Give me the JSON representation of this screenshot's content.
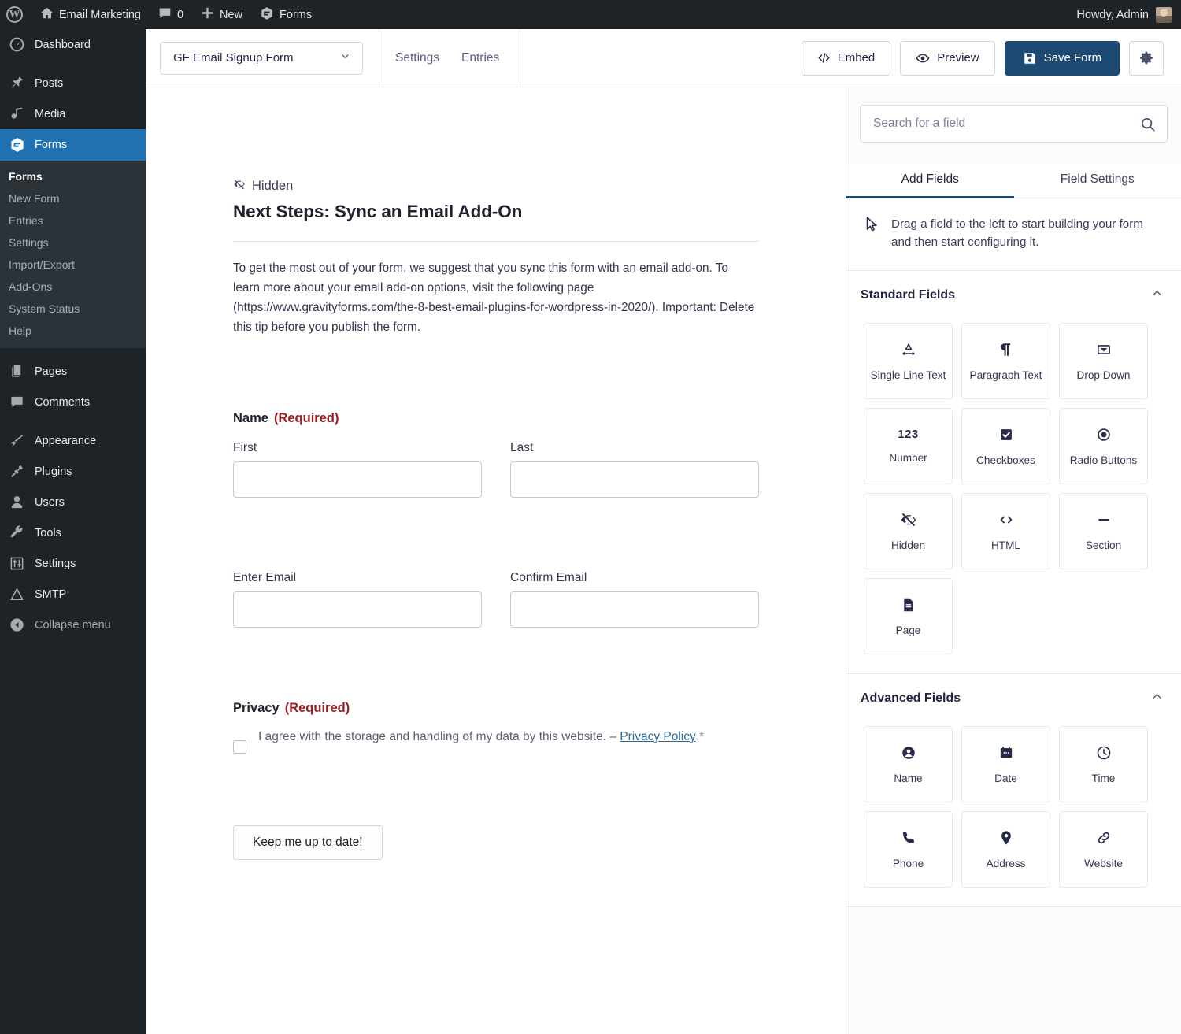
{
  "adminbar": {
    "site_title": "Email Marketing",
    "comments_count": "0",
    "new_label": "New",
    "forms_label": "Forms",
    "howdy": "Howdy, Admin"
  },
  "adminmenu": {
    "items": [
      {
        "label": "Dashboard",
        "icon": "dashboard-icon",
        "current": false
      },
      {
        "label": "Posts",
        "icon": "pin-icon",
        "current": false
      },
      {
        "label": "Media",
        "icon": "media-icon",
        "current": false
      },
      {
        "label": "Forms",
        "icon": "gravityforms-icon",
        "current": true
      }
    ],
    "submenu": [
      {
        "label": "Forms",
        "current": true
      },
      {
        "label": "New Form",
        "current": false
      },
      {
        "label": "Entries",
        "current": false
      },
      {
        "label": "Settings",
        "current": false
      },
      {
        "label": "Import/Export",
        "current": false
      },
      {
        "label": "Add-Ons",
        "current": false
      },
      {
        "label": "System Status",
        "current": false
      },
      {
        "label": "Help",
        "current": false
      }
    ],
    "items2": [
      {
        "label": "Pages",
        "icon": "pages-icon"
      },
      {
        "label": "Comments",
        "icon": "comment-icon"
      }
    ],
    "items3": [
      {
        "label": "Appearance",
        "icon": "brush-icon"
      },
      {
        "label": "Plugins",
        "icon": "plug-icon"
      },
      {
        "label": "Users",
        "icon": "user-icon"
      },
      {
        "label": "Tools",
        "icon": "wrench-icon"
      },
      {
        "label": "Settings",
        "icon": "sliders-icon"
      },
      {
        "label": "SMTP",
        "icon": "triangle-icon"
      }
    ],
    "collapse_label": "Collapse menu"
  },
  "editor_bar": {
    "form_name": "GF Email Signup Form",
    "tabs": [
      {
        "label": "Settings"
      },
      {
        "label": "Entries"
      }
    ],
    "embed_label": "Embed",
    "preview_label": "Preview",
    "save_label": "Save Form",
    "settings_icon": "gear-icon",
    "primary_color": "#1c4a72"
  },
  "form": {
    "html_field": {
      "tag": "Hidden",
      "tag_icon": "eye-off-icon",
      "title": "Next Steps: Sync an Email Add-On",
      "body": "To get the most out of your form, we suggest that you sync this form with an email add-on. To learn more about your email add-on options, visit the following page (https://www.gravityforms.com/the-8-best-email-plugins-for-wordpress-in-2020/). Important: Delete this tip before you publish the form."
    },
    "name_field": {
      "label": "Name",
      "required": "(Required)",
      "first_label": "First",
      "last_label": "Last",
      "first_value": "",
      "last_value": ""
    },
    "email_field": {
      "enter_label": "Enter Email",
      "confirm_label": "Confirm Email",
      "enter_value": "",
      "confirm_value": ""
    },
    "privacy_field": {
      "label": "Privacy",
      "required": "(Required)",
      "consent_text_before": "I agree with the storage and handling of my data by this website. – ",
      "consent_link": "Privacy Policy",
      "consent_text_after": " *"
    },
    "submit_label": "Keep me up to date!",
    "required_color": "#9b1c21"
  },
  "sidebar": {
    "search": {
      "placeholder": "Search for a field",
      "value": "",
      "icon": "search-icon"
    },
    "tabs": [
      {
        "label": "Add Fields",
        "active": true
      },
      {
        "label": "Field Settings",
        "active": false
      }
    ],
    "drag_hint": {
      "icon": "cursor-icon",
      "text": "Drag a field to the left to start building your form and then start configuring it."
    },
    "groups": [
      {
        "title": "Standard Fields",
        "chevron": "chevron-up-icon",
        "fields": [
          {
            "label": "Single Line Text",
            "icon": "single-line-text-icon"
          },
          {
            "label": "Paragraph Text",
            "icon": "paragraph-icon"
          },
          {
            "label": "Drop Down",
            "icon": "dropdown-icon"
          },
          {
            "label": "Number",
            "icon": "number-123-icon"
          },
          {
            "label": "Checkboxes",
            "icon": "checkbox-icon"
          },
          {
            "label": "Radio Buttons",
            "icon": "radio-icon"
          },
          {
            "label": "Hidden",
            "icon": "eye-off-icon"
          },
          {
            "label": "HTML",
            "icon": "code-icon"
          },
          {
            "label": "Section",
            "icon": "minus-icon"
          },
          {
            "label": "Page",
            "icon": "page-icon"
          }
        ]
      },
      {
        "title": "Advanced Fields",
        "chevron": "chevron-up-icon",
        "fields": [
          {
            "label": "Name",
            "icon": "person-circle-icon"
          },
          {
            "label": "Date",
            "icon": "calendar-icon"
          },
          {
            "label": "Time",
            "icon": "clock-icon"
          },
          {
            "label": "Phone",
            "icon": "phone-icon"
          },
          {
            "label": "Address",
            "icon": "map-pin-icon"
          },
          {
            "label": "Website",
            "icon": "link-icon"
          }
        ]
      }
    ]
  }
}
